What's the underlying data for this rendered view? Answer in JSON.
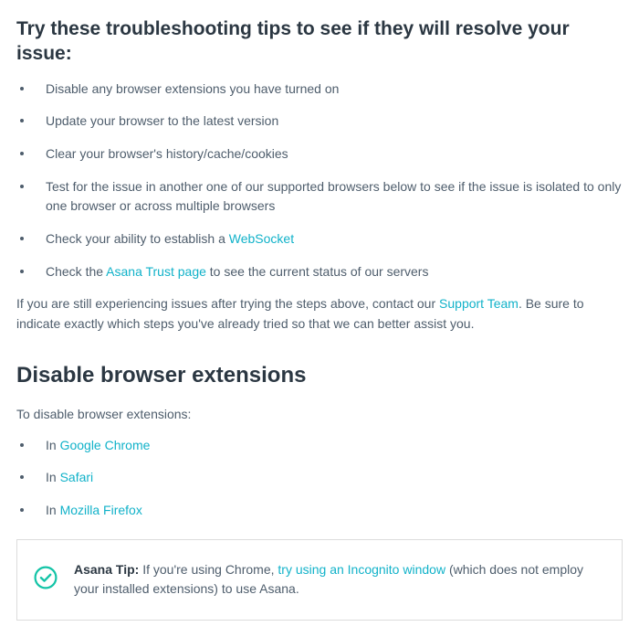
{
  "heading": "Try these troubleshooting tips to see if they will resolve your issue:",
  "tips": [
    {
      "text": "Disable any browser extensions you have turned on"
    },
    {
      "text": "Update your browser to the latest version"
    },
    {
      "text": "Clear your browser's history/cache/cookies"
    },
    {
      "text": "Test for the issue in another one of our supported browsers below to see if the issue is isolated to only one browser or across multiple browsers"
    },
    {
      "pre": "Check your ability to establish a ",
      "link": "WebSocket"
    },
    {
      "pre": "Check the ",
      "link": "Asana Trust page",
      "post": " to see the current status of our servers"
    }
  ],
  "followup": {
    "pre": "If you are still experiencing issues after trying the steps above, contact our ",
    "link": "Support Team",
    "post": ". Be sure to indicate exactly which steps you've already tried so that we can better assist you."
  },
  "section_heading": "Disable browser extensions",
  "section_intro": "To disable browser extensions:",
  "browsers": [
    {
      "pre": "In ",
      "link": "Google Chrome"
    },
    {
      "pre": "In ",
      "link": "Safari"
    },
    {
      "pre": "In ",
      "link": "Mozilla Firefox"
    }
  ],
  "tip_box": {
    "label": "Asana Tip:",
    "pre": " If you're using Chrome, ",
    "link": "try using an Incognito window",
    "post": " (which does not employ your installed extensions) to use Asana."
  }
}
